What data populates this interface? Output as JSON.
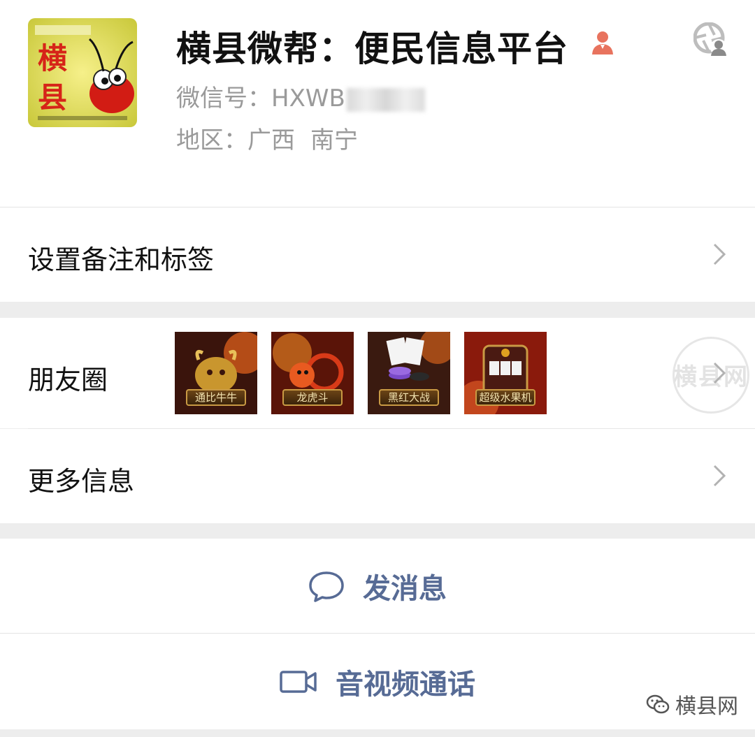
{
  "profile": {
    "name": "横县微帮：便民信息平台",
    "wechat_id_label": "微信号：",
    "wechat_id_visible": "HXWB",
    "region_label": "地区：",
    "region_province": "广西",
    "region_city": "南宁",
    "avatar_text": "横县",
    "gender": "female-icon"
  },
  "menu": {
    "remark_label": "设置备注和标签",
    "moments_label": "朋友圈",
    "more_info_label": "更多信息"
  },
  "moments_thumbnails": [
    {
      "caption": "通比牛牛"
    },
    {
      "caption": "龙虎斗"
    },
    {
      "caption": "黑红大战"
    },
    {
      "caption": "超级水果机"
    }
  ],
  "actions": {
    "message_label": "发消息",
    "call_label": "音视频通话"
  },
  "watermark": {
    "stamp_text": "横县网",
    "footer_text": "横县网"
  },
  "colors": {
    "link_blue": "#576b95",
    "background_gray": "#ededed",
    "gender_icon": "#e8735e"
  }
}
